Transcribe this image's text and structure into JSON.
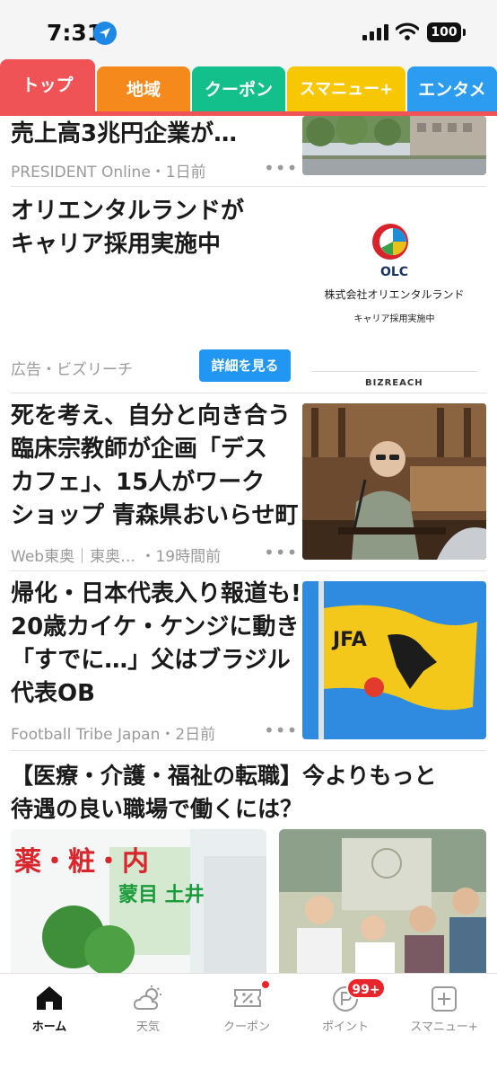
{
  "status": {
    "time": "7:31",
    "battery": "100"
  },
  "tabs": [
    {
      "label": "トップ",
      "color": "#f05356",
      "active": true
    },
    {
      "label": "地域",
      "color": "#f5891b"
    },
    {
      "label": "クーポン",
      "color": "#13c08b"
    },
    {
      "label": "スマニュー+",
      "color": "#f7c704"
    },
    {
      "label": "エンタメ",
      "color": "#2b9cef"
    }
  ],
  "articles": [
    {
      "title_lines": [
        "売上高3兆円企業が…"
      ],
      "source": "PRESIDENT Online・1日前"
    },
    {
      "title_lines": [
        "オリエンタルランドが",
        "キャリア採用実施中"
      ],
      "ad_label": "広告・ビズリーチ",
      "cta": "詳細を見る",
      "ad_logo_text": "OLC",
      "ad_company": "株式会社オリエンタルランド",
      "ad_recruit": "キャリア採用実施中",
      "ad_brand": "BIZREACH"
    },
    {
      "title_lines": [
        "死を考え、自分と向き合う",
        "臨床宗教師が企画「デス",
        "カフェ」、15人がワーク",
        "ショップ 青森県おいらせ町"
      ],
      "source": "Web東奥｜東奥… ・19時間前"
    },
    {
      "title_lines": [
        "帰化・日本代表入り報道も!",
        "20歳カイケ・ケンジに動き!",
        "「すでに…」父はブラジル",
        "代表OB"
      ],
      "source": "Football Tribe Japan・2日前",
      "flag_text": "JFA"
    },
    {
      "title_lines": [
        "【医療・介護・福祉の転職】今よりもっと",
        "待遇の良い職場で働くには？"
      ],
      "sign_text": "薬・粧・内",
      "sign_text2": "蒙目 土井"
    }
  ],
  "bottom_nav": [
    {
      "label": "ホーム",
      "icon": "home-icon",
      "active": true
    },
    {
      "label": "天気",
      "icon": "weather-icon"
    },
    {
      "label": "クーポン",
      "icon": "coupon-icon"
    },
    {
      "label": "ポイント",
      "icon": "points-icon",
      "badge": "99+"
    },
    {
      "label": "スマニュー+",
      "icon": "plus-square-icon"
    }
  ]
}
